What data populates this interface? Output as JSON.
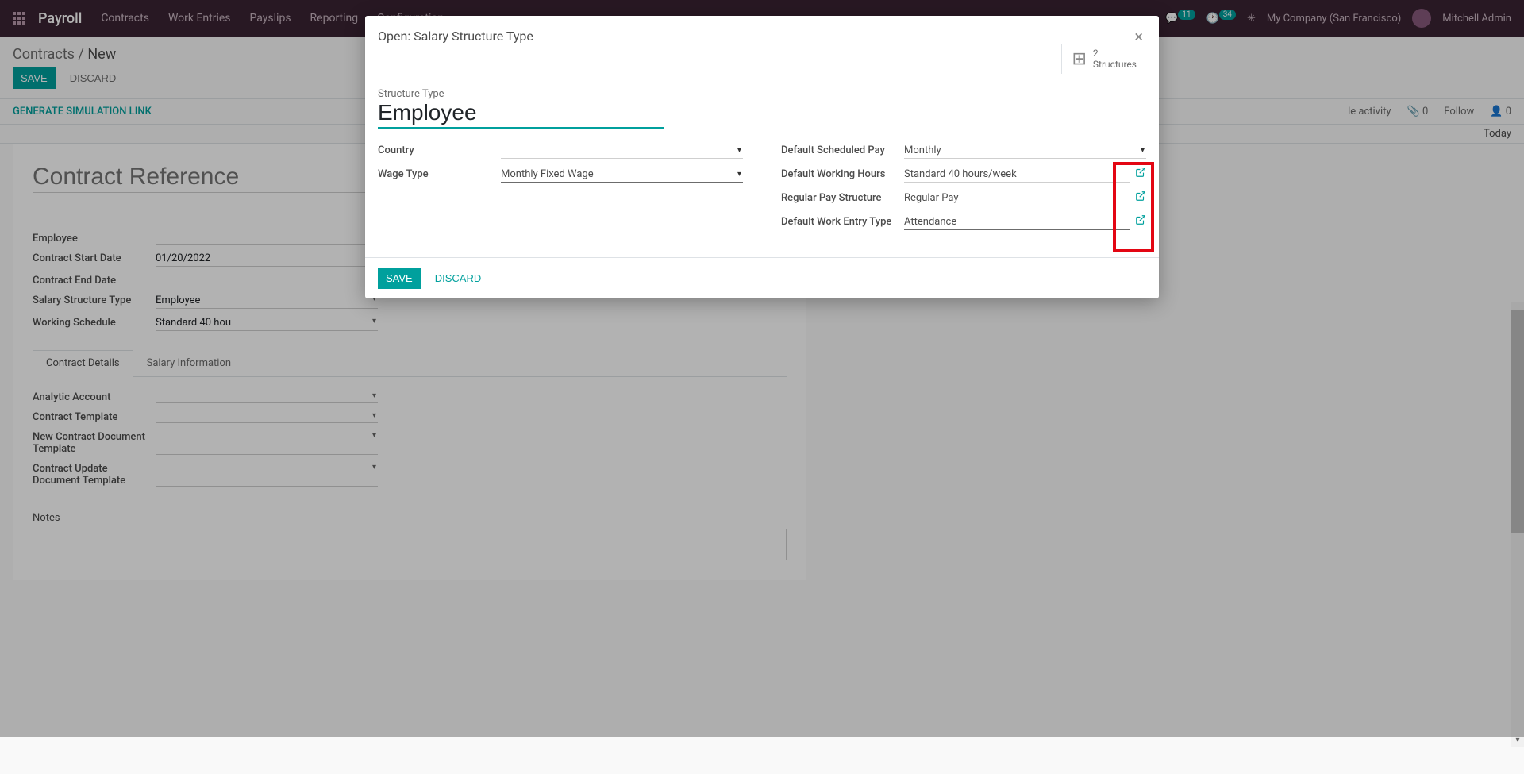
{
  "topnav": {
    "brand": "Payroll",
    "menu": [
      "Contracts",
      "Work Entries",
      "Payslips",
      "Reporting",
      "Configuration"
    ],
    "badges": {
      "messages": "11",
      "activities": "34"
    },
    "company": "My Company (San Francisco)",
    "user": "Mitchell Admin"
  },
  "cp": {
    "breadcrumb_root": "Contracts",
    "breadcrumb_current": "New",
    "save": "SAVE",
    "discard": "DISCARD"
  },
  "statusbar": {
    "generate": "GENERATE SIMULATION LINK",
    "activity": "le activity",
    "attach_count": "0",
    "follow": "Follow",
    "followers": "0",
    "today": "Today"
  },
  "sheet": {
    "title_placeholder": "Contract Reference",
    "fields": {
      "employee": "Employee",
      "start_date": "Contract Start Date",
      "start_date_val": "01/20/2022",
      "end_date": "Contract End Date",
      "structure_type": "Salary Structure Type",
      "structure_type_val": "Employee",
      "working_schedule": "Working Schedule",
      "working_schedule_val": "Standard 40 hou"
    },
    "tabs": {
      "details": "Contract Details",
      "salary": "Salary Information"
    },
    "details": {
      "analytic": "Analytic Account",
      "template": "Contract Template",
      "newdoc": "New Contract Document Template",
      "updatedoc": "Contract Update Document Template",
      "notes": "Notes"
    }
  },
  "modal": {
    "title": "Open: Salary Structure Type",
    "stat_count": "2",
    "stat_label": "Structures",
    "structure_type_label": "Structure Type",
    "structure_type_value": "Employee",
    "left": {
      "country": "Country",
      "wage_type": "Wage Type",
      "wage_type_val": "Monthly Fixed Wage"
    },
    "right": {
      "scheduled_pay": "Default Scheduled Pay",
      "scheduled_pay_val": "Monthly",
      "working_hours": "Default Working Hours",
      "working_hours_val": "Standard 40 hours/week",
      "pay_structure": "Regular Pay Structure",
      "pay_structure_val": "Regular Pay",
      "work_entry": "Default Work Entry Type",
      "work_entry_val": "Attendance"
    },
    "save": "SAVE",
    "discard": "DISCARD"
  }
}
